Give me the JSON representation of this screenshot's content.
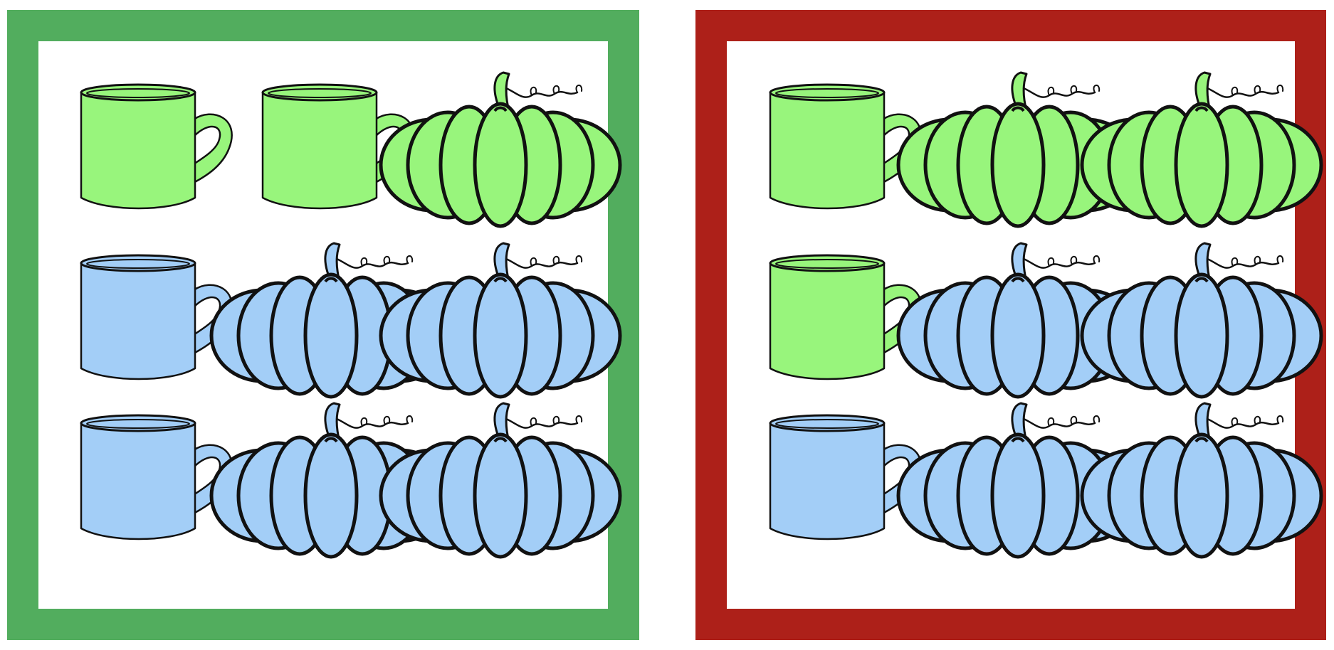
{
  "colors": {
    "green_frame": "#52ad5e",
    "red_frame": "#ad2019",
    "green_fill": "#98f57c",
    "blue_fill": "#a3cef7",
    "outline": "#111111"
  },
  "panels": [
    {
      "frame": "green",
      "grid": [
        [
          {
            "icon": "mug-icon",
            "color": "green"
          },
          {
            "icon": "mug-icon",
            "color": "green"
          },
          {
            "icon": "pumpkin-icon",
            "color": "green"
          }
        ],
        [
          {
            "icon": "mug-icon",
            "color": "blue"
          },
          {
            "icon": "pumpkin-icon",
            "color": "blue"
          },
          {
            "icon": "pumpkin-icon",
            "color": "blue"
          }
        ],
        [
          {
            "icon": "mug-icon",
            "color": "blue"
          },
          {
            "icon": "pumpkin-icon",
            "color": "blue"
          },
          {
            "icon": "pumpkin-icon",
            "color": "blue"
          }
        ]
      ]
    },
    {
      "frame": "red",
      "grid": [
        [
          {
            "icon": "mug-icon",
            "color": "green"
          },
          {
            "icon": "pumpkin-icon",
            "color": "green"
          },
          {
            "icon": "pumpkin-icon",
            "color": "green"
          }
        ],
        [
          {
            "icon": "mug-icon",
            "color": "green"
          },
          {
            "icon": "pumpkin-icon",
            "color": "blue"
          },
          {
            "icon": "pumpkin-icon",
            "color": "blue"
          }
        ],
        [
          {
            "icon": "mug-icon",
            "color": "blue"
          },
          {
            "icon": "pumpkin-icon",
            "color": "blue"
          },
          {
            "icon": "pumpkin-icon",
            "color": "blue"
          }
        ]
      ]
    }
  ]
}
